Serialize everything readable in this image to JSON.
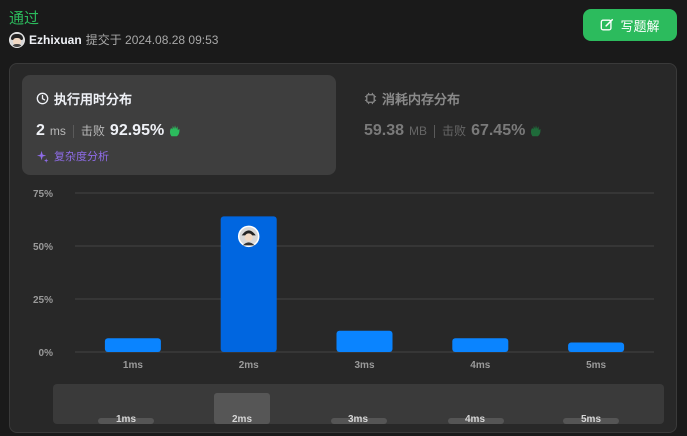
{
  "status": "通过",
  "author": {
    "name": "Ezhixuan",
    "meta": "提交于 2024.08.28 09:53"
  },
  "write_button": {
    "label": "写题解",
    "icon": "edit-icon"
  },
  "runtime": {
    "title": "执行用时分布",
    "value": "2",
    "unit": "ms",
    "beat_label": "击败",
    "beat_value": "92.95%",
    "analysis_link": "复杂度分析"
  },
  "memory": {
    "title": "消耗内存分布",
    "value": "59.38",
    "unit": "MB",
    "beat_label": "击败",
    "beat_value": "67.45%"
  },
  "colors": {
    "accent_green": "#2cbb5d",
    "bar_blue": "#0a84ff",
    "bar_selected": "#0066e0",
    "purple": "#8f6ce8"
  },
  "chart_data": {
    "type": "bar",
    "categories": [
      "1ms",
      "2ms",
      "3ms",
      "4ms",
      "5ms"
    ],
    "values": [
      6.5,
      64,
      10,
      6.5,
      4.5
    ],
    "y_ticks": [
      "0%",
      "25%",
      "50%",
      "75%"
    ],
    "ylim": [
      0,
      75
    ],
    "highlighted_category": "2ms",
    "grid": true
  },
  "navigator": {
    "labels": [
      "1ms",
      "2ms",
      "3ms",
      "4ms",
      "5ms"
    ]
  }
}
